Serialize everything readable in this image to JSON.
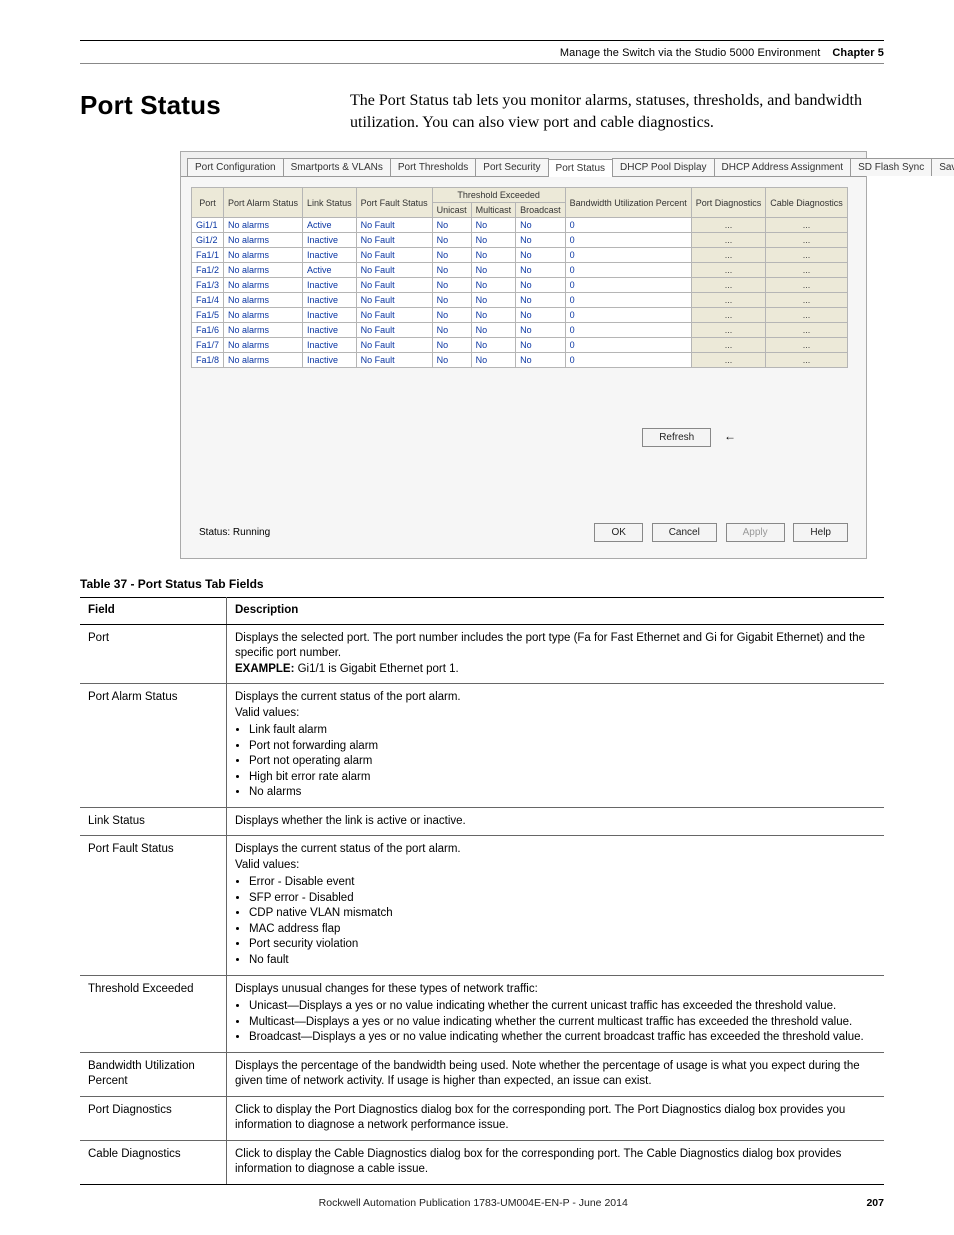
{
  "header": {
    "breadcrumb": "Manage the Switch via the Studio 5000 Environment",
    "chapter": "Chapter 5"
  },
  "section": {
    "title": "Port Status",
    "intro": "The Port Status tab lets you monitor alarms, statuses, thresholds, and bandwidth utilization. You can also view port and cable diagnostics."
  },
  "dialog": {
    "tabs": [
      "Port Configuration",
      "Smartports & VLANs",
      "Port Thresholds",
      "Port Security",
      "Port Status",
      "DHCP Pool Display",
      "DHCP Address Assignment",
      "SD Flash Sync",
      "Save/Restore"
    ],
    "active_tab_index": 4,
    "columns": {
      "port": "Port",
      "port_alarm_status": "Port Alarm Status",
      "link_status": "Link Status",
      "port_fault_status": "Port Fault Status",
      "threshold_exceeded": "Threshold Exceeded",
      "unicast": "Unicast",
      "multicast": "Multicast",
      "broadcast": "Broadcast",
      "bandwidth_util": "Bandwidth Utilization Percent",
      "port_diag": "Port Diagnostics",
      "cable_diag": "Cable Diagnostics"
    },
    "rows": [
      {
        "port": "Gi1/1",
        "alarm": "No alarms",
        "link": "Active",
        "fault": "No Fault",
        "uni": "No",
        "multi": "No",
        "broad": "No",
        "bw": "0",
        "pd": "...",
        "cd": "..."
      },
      {
        "port": "Gi1/2",
        "alarm": "No alarms",
        "link": "Inactive",
        "fault": "No Fault",
        "uni": "No",
        "multi": "No",
        "broad": "No",
        "bw": "0",
        "pd": "...",
        "cd": "..."
      },
      {
        "port": "Fa1/1",
        "alarm": "No alarms",
        "link": "Inactive",
        "fault": "No Fault",
        "uni": "No",
        "multi": "No",
        "broad": "No",
        "bw": "0",
        "pd": "...",
        "cd": "..."
      },
      {
        "port": "Fa1/2",
        "alarm": "No alarms",
        "link": "Active",
        "fault": "No Fault",
        "uni": "No",
        "multi": "No",
        "broad": "No",
        "bw": "0",
        "pd": "...",
        "cd": "..."
      },
      {
        "port": "Fa1/3",
        "alarm": "No alarms",
        "link": "Inactive",
        "fault": "No Fault",
        "uni": "No",
        "multi": "No",
        "broad": "No",
        "bw": "0",
        "pd": "...",
        "cd": "..."
      },
      {
        "port": "Fa1/4",
        "alarm": "No alarms",
        "link": "Inactive",
        "fault": "No Fault",
        "uni": "No",
        "multi": "No",
        "broad": "No",
        "bw": "0",
        "pd": "...",
        "cd": "..."
      },
      {
        "port": "Fa1/5",
        "alarm": "No alarms",
        "link": "Inactive",
        "fault": "No Fault",
        "uni": "No",
        "multi": "No",
        "broad": "No",
        "bw": "0",
        "pd": "...",
        "cd": "..."
      },
      {
        "port": "Fa1/6",
        "alarm": "No alarms",
        "link": "Inactive",
        "fault": "No Fault",
        "uni": "No",
        "multi": "No",
        "broad": "No",
        "bw": "0",
        "pd": "...",
        "cd": "..."
      },
      {
        "port": "Fa1/7",
        "alarm": "No alarms",
        "link": "Inactive",
        "fault": "No Fault",
        "uni": "No",
        "multi": "No",
        "broad": "No",
        "bw": "0",
        "pd": "...",
        "cd": "..."
      },
      {
        "port": "Fa1/8",
        "alarm": "No alarms",
        "link": "Inactive",
        "fault": "No Fault",
        "uni": "No",
        "multi": "No",
        "broad": "No",
        "bw": "0",
        "pd": "...",
        "cd": "..."
      }
    ],
    "refresh_label": "Refresh",
    "status_label": "Status: Running",
    "buttons": {
      "ok": "OK",
      "cancel": "Cancel",
      "apply": "Apply",
      "help": "Help"
    }
  },
  "table": {
    "caption": "Table 37 - Port Status Tab Fields",
    "head_field": "Field",
    "head_desc": "Description",
    "rows": [
      {
        "field": "Port",
        "desc_html": "Displays the selected port. The port number includes the port type (Fa for Fast Ethernet and Gi for Gigabit Ethernet) and the specific port number.<br><b>EXAMPLE:</b> Gi1/1 is Gigabit Ethernet port 1."
      },
      {
        "field": "Port Alarm Status",
        "desc_html": "Displays the current status of the port alarm.<br>Valid values:<ul><li>Link fault alarm</li><li>Port not forwarding alarm</li><li>Port not operating alarm</li><li>High bit error rate alarm</li><li>No alarms</li></ul>"
      },
      {
        "field": "Link Status",
        "desc_html": "Displays whether the link is active or inactive."
      },
      {
        "field": "Port Fault Status",
        "desc_html": "Displays the current status of the port alarm.<br>Valid values:<ul><li>Error - Disable event</li><li>SFP error - Disabled</li><li>CDP native VLAN mismatch</li><li>MAC address flap</li><li>Port security violation</li><li>No fault</li></ul>"
      },
      {
        "field": "Threshold Exceeded",
        "desc_html": "Displays unusual changes for these types of network traffic:<ul><li>Unicast—Displays a yes or no value indicating whether the current unicast traffic has exceeded the threshold value.</li><li>Multicast—Displays a yes or no value indicating whether the current multicast traffic has exceeded the threshold value.</li><li>Broadcast—Displays a yes or no value indicating whether the current broadcast traffic has exceeded the threshold value.</li></ul>"
      },
      {
        "field": "Bandwidth Utilization Percent",
        "desc_html": "Displays the percentage of the bandwidth being used. Note whether the percentage of usage is what you expect during the given time of network activity. If usage is higher than expected, an issue can exist."
      },
      {
        "field": "Port Diagnostics",
        "desc_html": "Click to display the Port Diagnostics dialog box for the corresponding port. The Port Diagnostics dialog box provides you information to diagnose a network performance issue."
      },
      {
        "field": "Cable Diagnostics",
        "desc_html": "Click to display the Cable Diagnostics dialog box for the corresponding port. The Cable Diagnostics dialog box provides information to diagnose a cable issue."
      }
    ]
  },
  "footer": {
    "publication": "Rockwell Automation Publication 1783-UM004E-EN-P - June 2014",
    "page": "207"
  }
}
